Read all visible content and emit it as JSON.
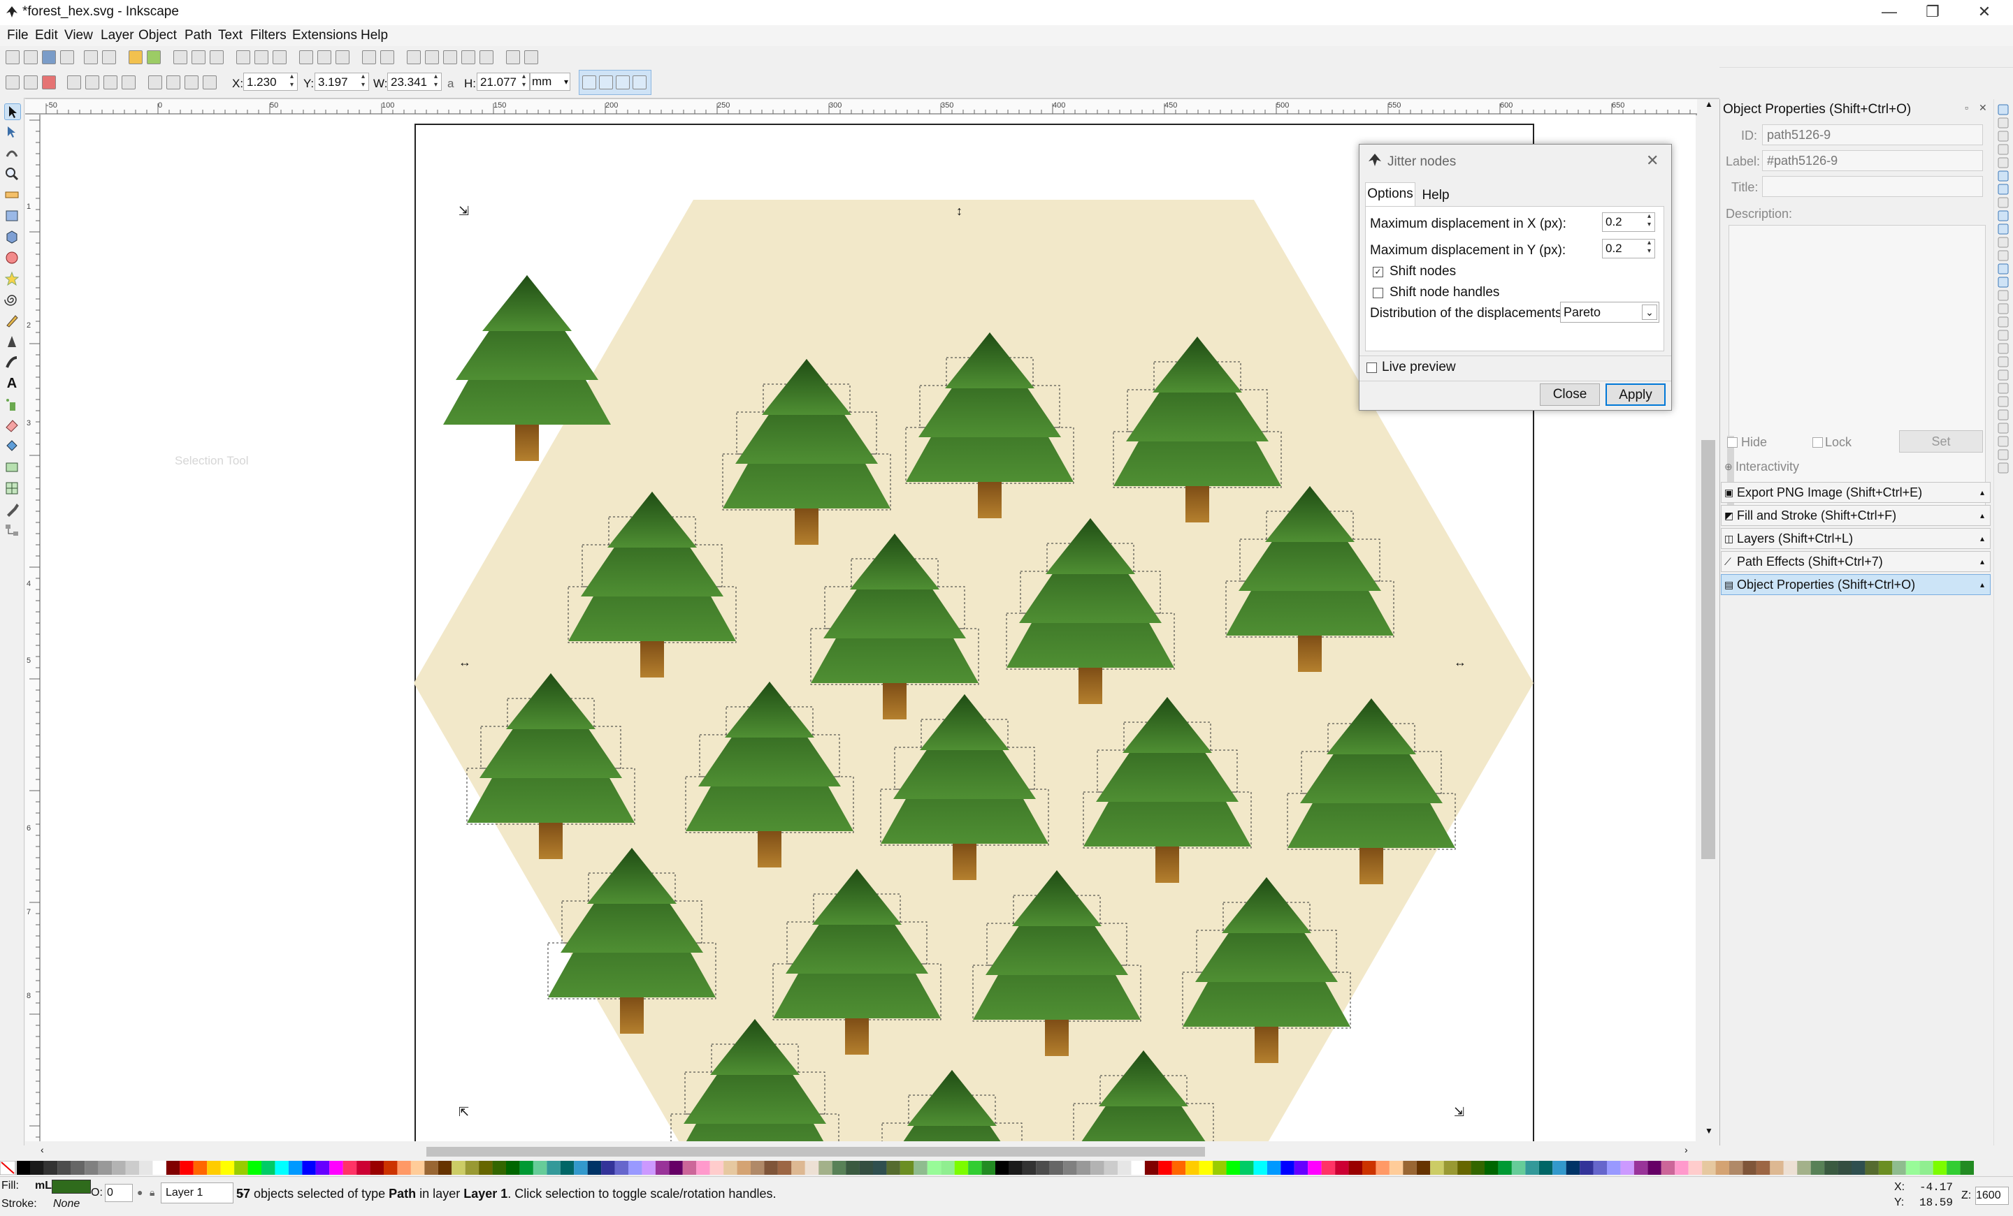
{
  "window": {
    "title": "*forest_hex.svg - Inkscape",
    "minimize": "—",
    "maximize": "❐",
    "close": "✕"
  },
  "menu": [
    "File",
    "Edit",
    "View",
    "Layer",
    "Object",
    "Path",
    "Text",
    "Filters",
    "Extensions",
    "Help"
  ],
  "controls": {
    "x_label": "X:",
    "x_value": "1.230",
    "y_label": "Y:",
    "y_value": "3.197",
    "w_label": "W:",
    "w_value": "23.341",
    "h_label": "H:",
    "h_value": "21.077",
    "lock_glyph": "a",
    "unit": "mm"
  },
  "ruler_h_ticks": [
    "-50",
    "0",
    "50",
    "100",
    "150",
    "200",
    "250",
    "300",
    "350",
    "400",
    "450",
    "500",
    "550",
    "600",
    "650"
  ],
  "ruler_v_ticks": [
    "1",
    "2",
    "3",
    "4",
    "5",
    "6",
    "7",
    "8"
  ],
  "dialog": {
    "title": "Jitter nodes",
    "tabs": [
      "Options",
      "Help"
    ],
    "max_x_label": "Maximum displacement in X (px):",
    "max_x_value": "0.2",
    "max_y_label": "Maximum displacement in Y (px):",
    "max_y_value": "0.2",
    "shift_nodes_label": "Shift nodes",
    "shift_nodes_checked": true,
    "shift_handles_label": "Shift node handles",
    "shift_handles_checked": false,
    "dist_label": "Distribution of the displacements:",
    "dist_value": "Pareto",
    "live_preview_label": "Live preview",
    "close_label": "Close",
    "apply_label": "Apply"
  },
  "dock": {
    "header": "Object Properties (Shift+Ctrl+O)",
    "id_label": "ID:",
    "id_value": "path5126-9",
    "label_label": "Label:",
    "label_value": "#path5126-9",
    "title_label": "Title:",
    "title_value": "",
    "description_label": "Description:",
    "hide_label": "Hide",
    "lock_label": "Lock",
    "set_label": "Set",
    "interactivity_label": "Interactivity",
    "panels": [
      "Export PNG Image (Shift+Ctrl+E)",
      "Fill and Stroke (Shift+Ctrl+F)",
      "Layers (Shift+Ctrl+L)",
      "Path Effects  (Shift+Ctrl+7)",
      "Object Properties (Shift+Ctrl+O)"
    ]
  },
  "canvas_tooltip": "Selection Tool",
  "status": {
    "fill_label": "Fill:",
    "fill_value": "mL",
    "stroke_label": "Stroke:",
    "stroke_value": "None",
    "opacity_label": "O:",
    "opacity_value": "0",
    "layer": "Layer 1",
    "message_count": "57",
    "message_a": " objects selected of type ",
    "message_type": "Path",
    "message_b": " in layer ",
    "message_layer": "Layer 1",
    "message_c": ". Click selection to toggle scale/rotation handles.",
    "cursor_x_label": "X:",
    "cursor_x": "-4.17",
    "cursor_y_label": "Y:",
    "cursor_y": "18.59",
    "zoom_label": "Z:",
    "zoom_value": "1600"
  },
  "colors": {
    "hex_fill": "#f2e8c9",
    "tree_dark": "#2a5e1a",
    "tree_light": "#4d8a30",
    "trunk": "#a06a26",
    "accent": "#0078d7"
  }
}
